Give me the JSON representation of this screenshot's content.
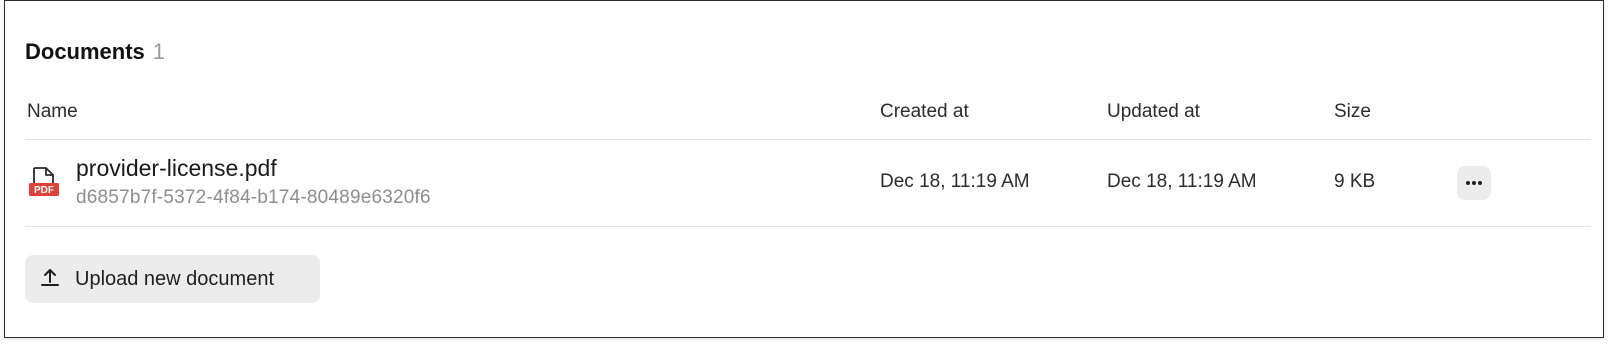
{
  "documents": {
    "title": "Documents",
    "count": "1",
    "columns": {
      "name": "Name",
      "created_at": "Created at",
      "updated_at": "Updated at",
      "size": "Size"
    },
    "rows": [
      {
        "file_name": "provider-license.pdf",
        "file_id": "d6857b7f-5372-4f84-b174-80489e6320f6",
        "file_type_badge": "PDF",
        "file_icon": "pdf-file-icon",
        "created_at": "Dec 18, 11:19 AM",
        "updated_at": "Dec 18, 11:19 AM",
        "size": "9 KB",
        "more_icon": "more-horizontal-icon"
      }
    ],
    "upload_button": {
      "label": "Upload new document",
      "icon": "upload-icon"
    }
  },
  "colors": {
    "pdf_badge": "#e0413a",
    "button_bg": "#ececec",
    "muted_text": "#8e8e8e",
    "divider": "#e3e3e3"
  }
}
